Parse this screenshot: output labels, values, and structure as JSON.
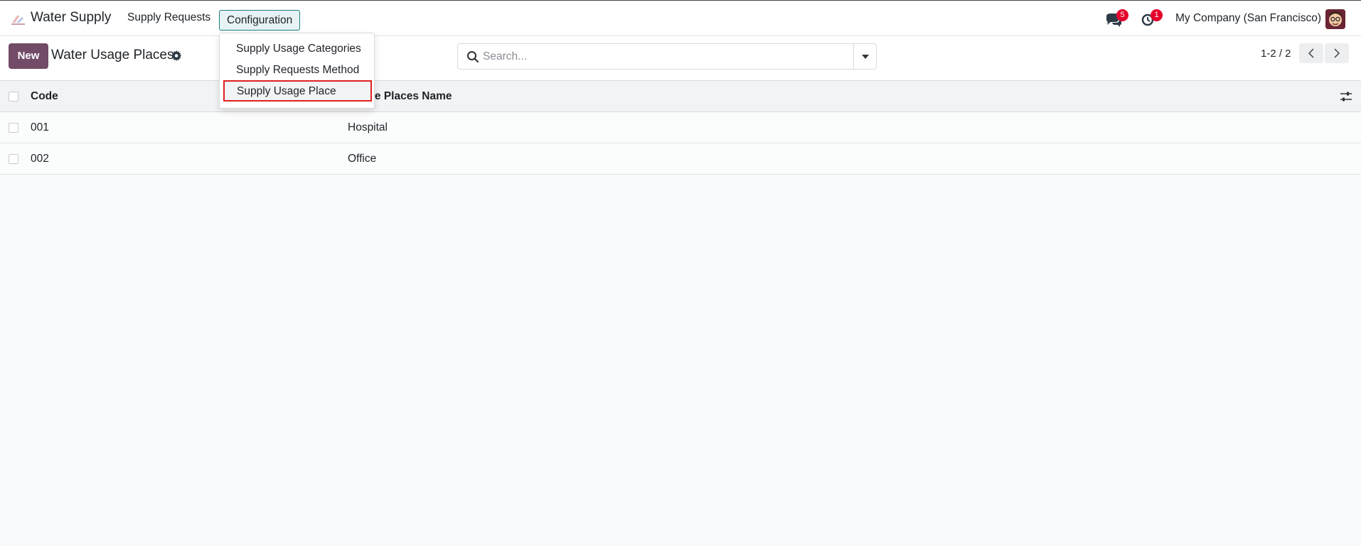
{
  "navbar": {
    "app_name": "Water Supply",
    "menu": [
      "Supply Requests",
      "Configuration"
    ],
    "messages_badge": "5",
    "activity_badge": "1",
    "company": "My Company (San Francisco)"
  },
  "config_menu": {
    "items": [
      "Supply Usage Categories",
      "Supply Requests Method",
      "Supply Usage Place"
    ]
  },
  "control": {
    "new_label": "New",
    "title": "Water Usage Places",
    "search_placeholder": "Search...",
    "pager": "1-2 / 2"
  },
  "table": {
    "headers": [
      "Code",
      "Usage Places Name"
    ],
    "rows": [
      {
        "code": "001",
        "name": "Hospital"
      },
      {
        "code": "002",
        "name": "Office"
      }
    ]
  }
}
